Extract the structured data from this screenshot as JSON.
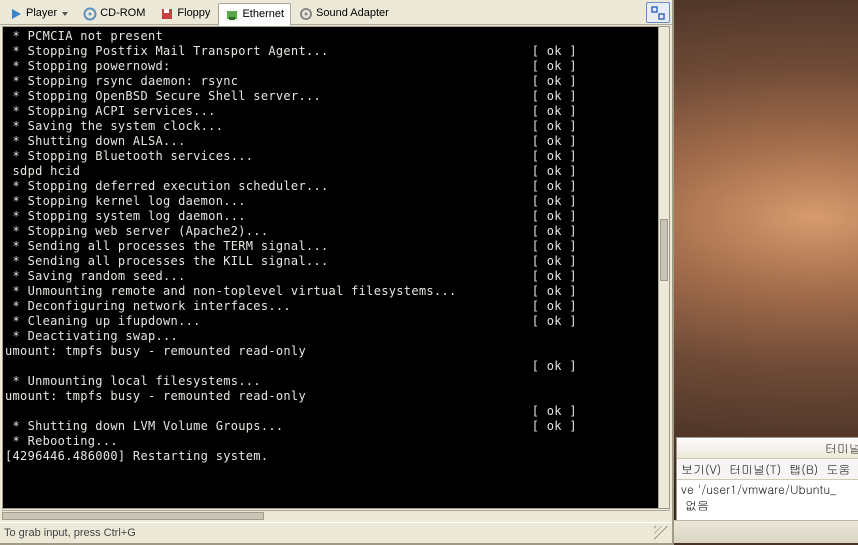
{
  "toolbar": {
    "player": "Player",
    "cdrom": "CD-ROM",
    "floppy": "Floppy",
    "ethernet": "Ethernet",
    "sound": "Sound Adapter"
  },
  "status_hint": "To grab input, press Ctrl+G",
  "console": {
    "lines": [
      {
        "text": " * PCMCIA not present"
      },
      {
        "text": " * Stopping Postfix Mail Transport Agent...",
        "status": "[ ok ]"
      },
      {
        "text": " * Stopping powernowd:",
        "status": "[ ok ]"
      },
      {
        "text": " * Stopping rsync daemon: rsync",
        "status": "[ ok ]"
      },
      {
        "text": " * Stopping OpenBSD Secure Shell server...",
        "status": "[ ok ]"
      },
      {
        "text": " * Stopping ACPI services...",
        "status": "[ ok ]"
      },
      {
        "text": " * Saving the system clock...",
        "status": "[ ok ]"
      },
      {
        "text": " * Shutting down ALSA...",
        "status": "[ ok ]"
      },
      {
        "text": " * Stopping Bluetooth services...",
        "status": "[ ok ]"
      },
      {
        "text": " sdpd hcid",
        "status": "[ ok ]"
      },
      {
        "text": " * Stopping deferred execution scheduler...",
        "status": "[ ok ]"
      },
      {
        "text": " * Stopping kernel log daemon...",
        "status": "[ ok ]"
      },
      {
        "text": " * Stopping system log daemon...",
        "status": "[ ok ]"
      },
      {
        "text": " * Stopping web server (Apache2)...",
        "status": "[ ok ]"
      },
      {
        "text": " * Sending all processes the TERM signal...",
        "status": "[ ok ]"
      },
      {
        "text": " * Sending all processes the KILL signal...",
        "status": "[ ok ]"
      },
      {
        "text": " * Saving random seed...",
        "status": "[ ok ]"
      },
      {
        "text": " * Unmounting remote and non-toplevel virtual filesystems...",
        "status": "[ ok ]"
      },
      {
        "text": " * Deconfiguring network interfaces...",
        "status": "[ ok ]"
      },
      {
        "text": " * Cleaning up ifupdown...",
        "status": "[ ok ]"
      },
      {
        "text": " * Deactivating swap..."
      },
      {
        "text": "umount: tmpfs busy - remounted read-only"
      },
      {
        "text": "",
        "status": "[ ok ]"
      },
      {
        "text": " * Unmounting local filesystems..."
      },
      {
        "text": "umount: tmpfs busy - remounted read-only"
      },
      {
        "text": "",
        "status": "[ ok ]"
      },
      {
        "text": " * Shutting down LVM Volume Groups...",
        "status": "[ ok ]"
      },
      {
        "text": " * Rebooting..."
      },
      {
        "text": "[4296446.486000] Restarting system."
      }
    ],
    "status_column": 70
  },
  "terminal_window": {
    "title": "터미널",
    "menu": [
      "보기(V)",
      "터미널(T)",
      "탭(B)",
      "도움"
    ],
    "body_lines": [
      "ve '/user1/vmware/Ubuntu_",
      " 없음"
    ]
  }
}
